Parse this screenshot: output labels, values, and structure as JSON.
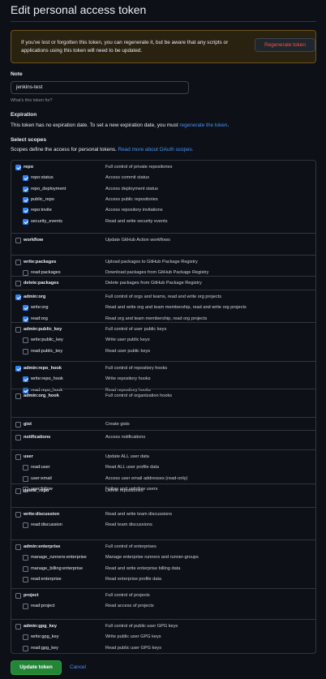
{
  "page": {
    "title": "Edit personal access token"
  },
  "warning": {
    "text": "If you've lost or forgotten this token, you can regenerate it, but be aware that any scripts or applications using this token will need to be updated.",
    "regenerate_label": "Regenerate token"
  },
  "note": {
    "label": "Note",
    "value": "jenkins-test",
    "hint": "What's this token for?"
  },
  "expiration": {
    "label": "Expiration",
    "text": "This token has no expiration date. To set a new expiration date, you must ",
    "link": "regenerate the token",
    "suffix": "."
  },
  "scopes_section": {
    "label": "Select scopes",
    "text": "Scopes define the access for personal tokens. ",
    "link": "Read more about OAuth scopes."
  },
  "scope_groups": [
    {
      "name": "repo",
      "desc": "Full control of private repositories",
      "checked": true,
      "children": [
        {
          "name": "repo:status",
          "desc": "Access commit status",
          "checked": true
        },
        {
          "name": "repo_deployment",
          "desc": "Access deployment status",
          "checked": true
        },
        {
          "name": "public_repo",
          "desc": "Access public repositories",
          "checked": true
        },
        {
          "name": "repo:invite",
          "desc": "Access repository invitations",
          "checked": true
        },
        {
          "name": "security_events",
          "desc": "Read and write security events",
          "checked": true
        }
      ]
    },
    {
      "name": "workflow",
      "desc": "Update GitHub Action workflows",
      "checked": false,
      "children": []
    },
    {
      "name": "write:packages",
      "desc": "Upload packages to GitHub Package Registry",
      "checked": false,
      "children": [
        {
          "name": "read:packages",
          "desc": "Download packages from GitHub Package Registry",
          "checked": false
        }
      ]
    },
    {
      "name": "delete:packages",
      "desc": "Delete packages from GitHub Package Registry",
      "checked": false,
      "children": []
    },
    {
      "name": "admin:org",
      "desc": "Full control of orgs and teams, read and write org projects",
      "checked": true,
      "children": [
        {
          "name": "write:org",
          "desc": "Read and write org and team membership, read and write org projects",
          "checked": true
        },
        {
          "name": "read:org",
          "desc": "Read org and team membership, read org projects",
          "checked": true
        }
      ]
    },
    {
      "name": "admin:public_key",
      "desc": "Full control of user public keys",
      "checked": false,
      "children": [
        {
          "name": "write:public_key",
          "desc": "Write user public keys",
          "checked": false
        },
        {
          "name": "read:public_key",
          "desc": "Read user public keys",
          "checked": false
        }
      ]
    },
    {
      "name": "admin:repo_hook",
      "desc": "Full control of repository hooks",
      "checked": true,
      "children": [
        {
          "name": "write:repo_hook",
          "desc": "Write repository hooks",
          "checked": true
        },
        {
          "name": "read:repo_hook",
          "desc": "Read repository hooks",
          "checked": true
        }
      ]
    },
    {
      "name": "admin:org_hook",
      "desc": "Full control of organization hooks",
      "checked": false,
      "children": []
    },
    {
      "name": "gist",
      "desc": "Create gists",
      "checked": false,
      "children": []
    },
    {
      "name": "notifications",
      "desc": "Access notifications",
      "checked": false,
      "children": []
    },
    {
      "name": "user",
      "desc": "Update ALL user data",
      "checked": false,
      "children": [
        {
          "name": "read:user",
          "desc": "Read ALL user profile data",
          "checked": false
        },
        {
          "name": "user:email",
          "desc": "Access user email addresses (read-only)",
          "checked": false
        },
        {
          "name": "user:follow",
          "desc": "Follow and unfollow users",
          "checked": false
        }
      ]
    },
    {
      "name": "delete_repo",
      "desc": "Delete repositories",
      "checked": false,
      "children": []
    },
    {
      "name": "write:discussion",
      "desc": "Read and write team discussions",
      "checked": false,
      "children": [
        {
          "name": "read:discussion",
          "desc": "Read team discussions",
          "checked": false
        }
      ]
    },
    {
      "name": "admin:enterprise",
      "desc": "Full control of enterprises",
      "checked": false,
      "children": [
        {
          "name": "manage_runners:enterprise",
          "desc": "Manage enterprise runners and runner-groups",
          "checked": false
        },
        {
          "name": "manage_billing:enterprise",
          "desc": "Read and write enterprise billing data",
          "checked": false
        },
        {
          "name": "read:enterprise",
          "desc": "Read enterprise profile data",
          "checked": false
        }
      ]
    },
    {
      "name": "project",
      "desc": "Full control of projects",
      "checked": false,
      "children": [
        {
          "name": "read:project",
          "desc": "Read access of projects",
          "checked": false
        }
      ]
    },
    {
      "name": "admin:gpg_key",
      "desc": "Full control of public user GPG keys",
      "checked": false,
      "children": [
        {
          "name": "write:gpg_key",
          "desc": "Write public user GPG keys",
          "checked": false
        },
        {
          "name": "read:gpg_key",
          "desc": "Read public user GPG keys",
          "checked": false
        }
      ]
    }
  ],
  "actions": {
    "update_label": "Update token",
    "cancel_label": "Cancel"
  },
  "colors": {
    "background": "#0d1117",
    "accent": "#2f81f7",
    "link": "#4493f8",
    "primary_button": "#238636",
    "danger": "#f85149",
    "warning_bg": "#2a2211"
  }
}
